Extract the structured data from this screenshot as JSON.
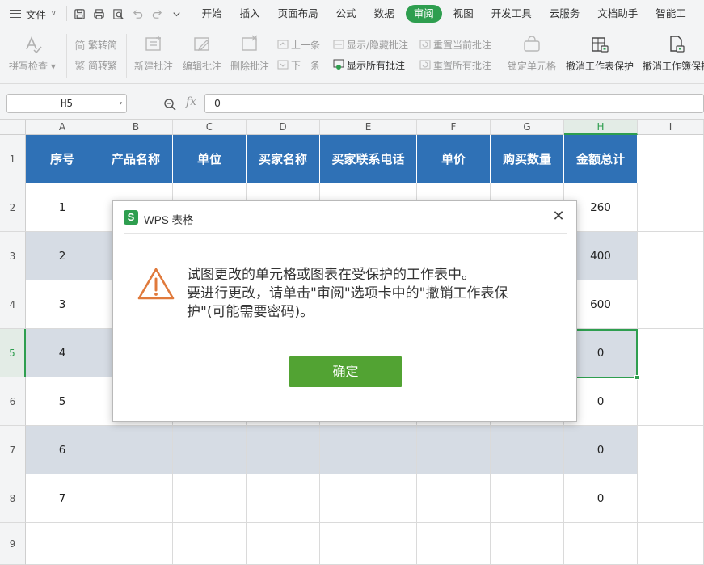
{
  "menubar": {
    "file_label": "文件",
    "tabs": [
      {
        "label": "开始",
        "active": false
      },
      {
        "label": "插入",
        "active": false
      },
      {
        "label": "页面布局",
        "active": false
      },
      {
        "label": "公式",
        "active": false
      },
      {
        "label": "数据",
        "active": false
      },
      {
        "label": "审阅",
        "active": true
      },
      {
        "label": "视图",
        "active": false
      },
      {
        "label": "开发工具",
        "active": false
      },
      {
        "label": "云服务",
        "active": false
      },
      {
        "label": "文档助手",
        "active": false
      },
      {
        "label": "智能工",
        "active": false
      }
    ]
  },
  "ribbon": {
    "spellcheck": "拼写检查",
    "trad_to_simp": "繁转简",
    "simp_to_trad": "简转繁",
    "new_comment": "新建批注",
    "edit_comment": "编辑批注",
    "delete_comment": "删除批注",
    "prev": "上一条",
    "next": "下一条",
    "show_hide_comment": "显示/隐藏批注",
    "show_all_comments": "显示所有批注",
    "reset_current_comment": "重置当前批注",
    "reset_all_comments": "重置所有批注",
    "lock_cell": "锁定单元格",
    "unprotect_sheet": "撤消工作表保护",
    "unprotect_workbook": "撤消工作簿保护"
  },
  "formula_bar": {
    "cell_ref": "H5",
    "fx": "fx",
    "value": "0"
  },
  "sheet": {
    "columns": [
      "A",
      "B",
      "C",
      "D",
      "E",
      "F",
      "G",
      "H",
      "I"
    ],
    "rows": [
      "1",
      "2",
      "3",
      "4",
      "5",
      "6",
      "7",
      "8",
      "9"
    ],
    "headers": [
      "序号",
      "产品名称",
      "单位",
      "买家名称",
      "买家联系电话",
      "单价",
      "购买数量",
      "金额总计"
    ],
    "seq": [
      "1",
      "2",
      "3",
      "4",
      "5",
      "6",
      "7"
    ],
    "totals": [
      "260",
      "400",
      "600",
      "0",
      "0",
      "0",
      "0"
    ]
  },
  "colors": {
    "accent": "#2e9e4f",
    "header_fill": "#2f71b6",
    "band_fill": "#d6dce4",
    "ok_button": "#52a333",
    "warning": "#e07a3c"
  },
  "dialog": {
    "title": "WPS 表格",
    "logo_letter": "S",
    "close_glyph": "✕",
    "message": "试图更改的单元格或图表在受保护的工作表中。\n要进行更改，请单击\"审阅\"选项卡中的\"撤销工作表保护\"(可能需要密码)。",
    "ok_label": "确定"
  }
}
